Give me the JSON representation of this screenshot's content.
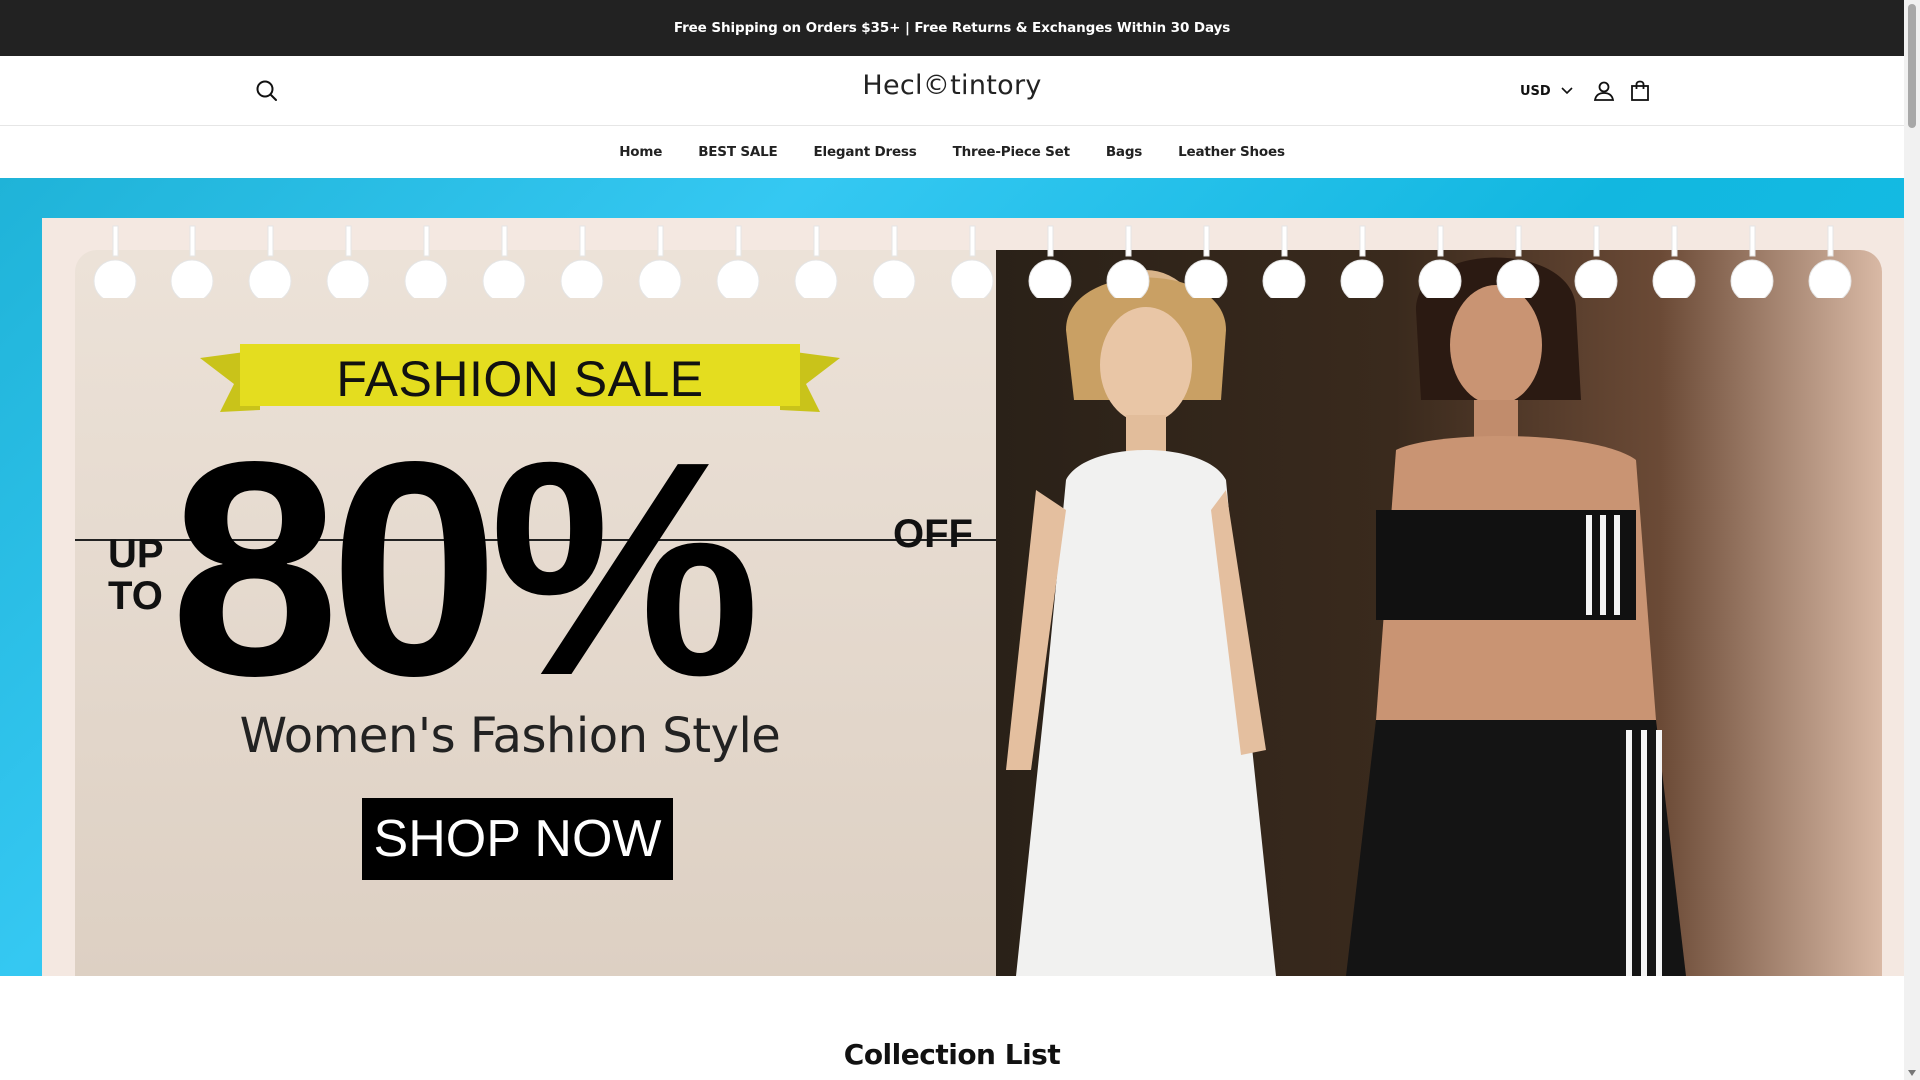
{
  "announcement": {
    "text": "Free Shipping on Orders $35+ | Free Returns & Exchanges Within 30 Days"
  },
  "header": {
    "logo": "Hecl©tintory",
    "currency": "USD"
  },
  "nav": {
    "items": [
      {
        "label": "Home"
      },
      {
        "label": "BEST SALE"
      },
      {
        "label": "Elegant Dress"
      },
      {
        "label": "Three-Piece Set"
      },
      {
        "label": "Bags"
      },
      {
        "label": "Leather Shoes"
      }
    ]
  },
  "hero": {
    "banner_label": "FASHION SALE",
    "up_to": "UP TO",
    "discount": "80%",
    "off": "OFF",
    "subtitle": "Women's Fashion Style",
    "cta": "SHOP NOW",
    "colors": {
      "banner_yellow": "#e4dd1f",
      "backdrop_cyan": "#1fb3d8"
    }
  },
  "section": {
    "title": "Collection List"
  },
  "icons": [
    "search-icon",
    "chevron-down-icon",
    "account-icon",
    "cart-icon"
  ]
}
